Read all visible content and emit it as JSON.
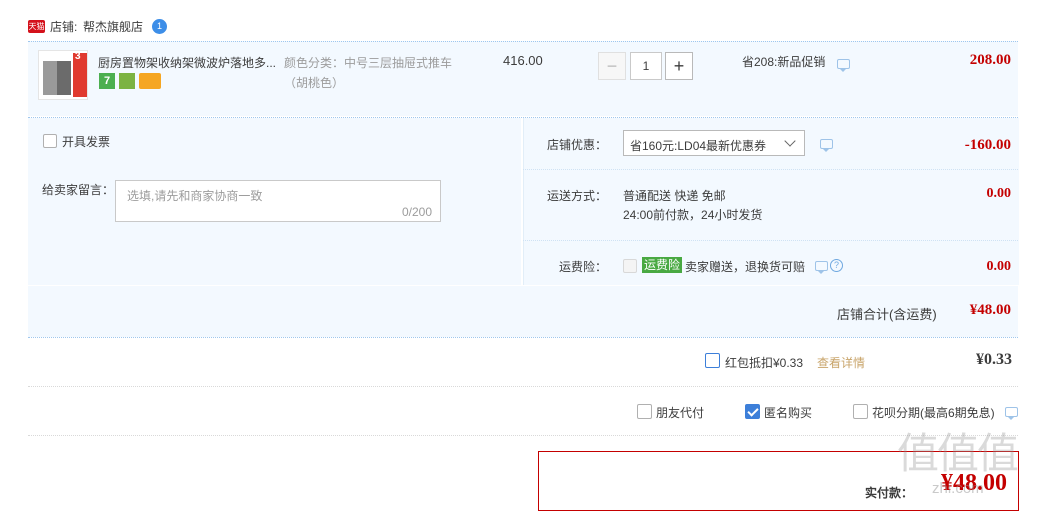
{
  "shop": {
    "badge": "天猫",
    "label": "店铺:",
    "name": "帮杰旗舰店",
    "bubble": "1"
  },
  "item": {
    "title": "厨房置物架收纳架微波炉落地多...",
    "thumb_badge": "3",
    "icon7": "7",
    "spec_label": "颜色分类：",
    "spec_value": "中号三层抽屉式推车",
    "spec_value2": "（胡桃色）",
    "price": "416.00",
    "qty": "1",
    "minus": "−",
    "plus": "+",
    "promo": "省208:新品促销",
    "subtotal": "208.00"
  },
  "invoice": {
    "label": "开具发票"
  },
  "message": {
    "label": "给卖家留言：",
    "placeholder": "选填,请先和商家协商一致",
    "counter": "0/200"
  },
  "discount": {
    "label": "店铺优惠：",
    "selected": "省160元:LD04最新优惠券",
    "amount": "-160.00"
  },
  "shipping": {
    "label": "运送方式：",
    "line1": "普通配送 快递 免邮",
    "line2": "24:00前付款，24小时发货",
    "amount": "0.00"
  },
  "insurance": {
    "label": "运费险：",
    "badge": "运费险",
    "text": "卖家赠送，退换货可赔",
    "amount": "0.00"
  },
  "shop_total": {
    "label": "店铺合计(含运费)",
    "amount": "¥48.00"
  },
  "redpacket": {
    "label": "红包抵扣¥0.33",
    "link": "查看详情",
    "amount": "¥0.33"
  },
  "options": {
    "friend_pay": "朋友代付",
    "anonymous": "匿名购买",
    "huabei": "花呗分期(最高6期免息)"
  },
  "pay": {
    "label": "实付款：",
    "amount": "¥48.00"
  },
  "watermark": {
    "text": "值值值",
    "sub": "什么值得买",
    "domain": "zhi.com"
  }
}
